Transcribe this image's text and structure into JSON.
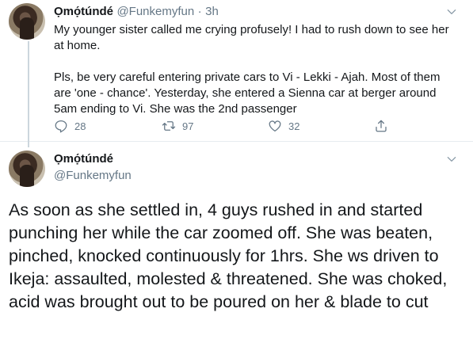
{
  "tweet1": {
    "author_name": "Ọmọ́túndé",
    "author_handle": "@Funkemyfun",
    "separator": "·",
    "time": "3h",
    "text_p1": "My younger sister called me crying profusely! I had to rush down to see her at home.",
    "text_p2": "Pls, be very careful entering private cars to Vi - Lekki - Ajah. Most of them are 'one - chance'. Yesterday, she entered a Sienna car at berger around 5am ending to Vi. She was the 2nd passenger",
    "actions": {
      "reply_count": "28",
      "retweet_count": "97",
      "like_count": "32"
    }
  },
  "tweet2": {
    "author_name": "Ọmọ́túndé",
    "author_handle": "@Funkemyfun",
    "text": "As soon as she settled in, 4 guys rushed in and started punching her while the car zoomed off. She was beaten, pinched, knocked continuously for 1hrs. She ws driven to Ikeja: assaulted, molested & threatened. She was choked, acid was brought out to be poured on her & blade to cut"
  },
  "icons": {
    "reply": "reply-icon",
    "retweet": "retweet-icon",
    "like": "heart-icon",
    "share": "share-icon",
    "menu": "chevron-down-icon"
  },
  "colors": {
    "text": "#14171a",
    "secondary": "#657786",
    "divider": "#e6ecf0"
  }
}
